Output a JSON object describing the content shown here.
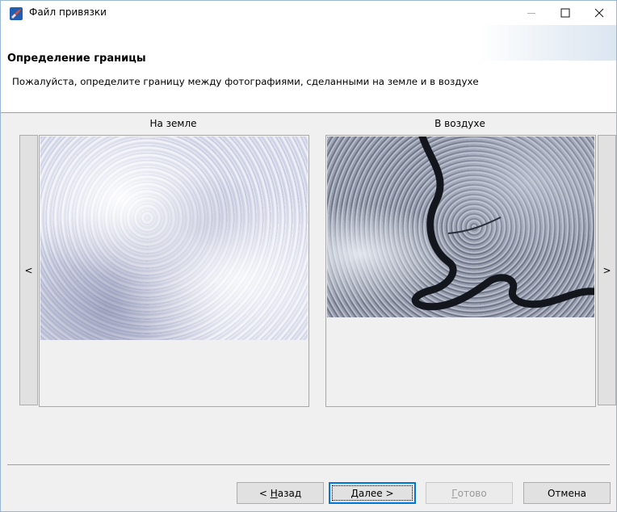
{
  "window": {
    "title": "Файл привязки"
  },
  "header": {
    "title": "Определение границы",
    "description": "Пожалуйста, определите границу между фотографиями, сделанными на земле и в воздухе"
  },
  "panels": {
    "left_label": "На земле",
    "right_label": "В воздухе"
  },
  "nav": {
    "prev": "<",
    "next": ">"
  },
  "buttons": {
    "back": {
      "label": "< ",
      "mnemonic": "Н",
      "rest": "азад"
    },
    "next": {
      "mnemonic": "Д",
      "rest": "алее >"
    },
    "finish": {
      "mnemonic": "Г",
      "rest": "отово"
    },
    "cancel": "Отмена"
  },
  "icons": {
    "app": "app-logo-icon",
    "minimize": "minimize-icon",
    "maximize": "maximize-icon",
    "close": "close-icon"
  }
}
